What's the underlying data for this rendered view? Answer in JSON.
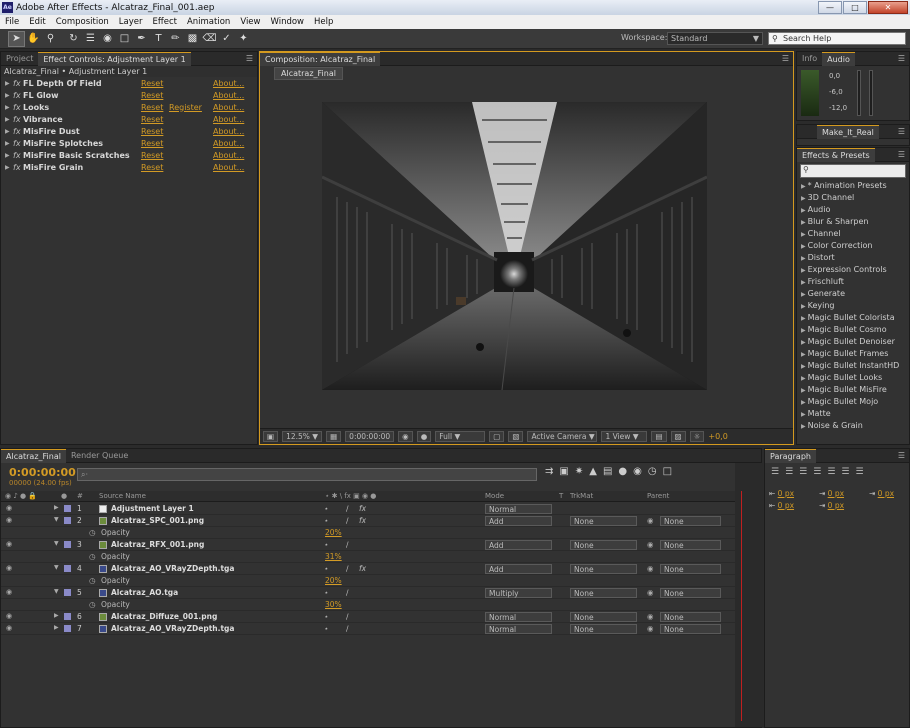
{
  "window": {
    "title": "Adobe After Effects - Alcatraz_Final_001.aep",
    "logo": "Ae"
  },
  "menu": [
    "File",
    "Edit",
    "Composition",
    "Layer",
    "Effect",
    "Animation",
    "View",
    "Window",
    "Help"
  ],
  "toolbar": {
    "workspace_label": "Workspace:",
    "workspace_value": "Standard",
    "search_placeholder": "Search Help"
  },
  "project_panel": {
    "tab_project": "Project",
    "tab_effect_controls": "Effect Controls: Adjustment Layer 1",
    "subtitle": "Alcatraz_Final • Adjustment Layer 1"
  },
  "effects": [
    {
      "name": "FL Depth Of Field",
      "reset": "Reset",
      "register": "",
      "about": "About..."
    },
    {
      "name": "FL Glow",
      "reset": "Reset",
      "register": "",
      "about": "About..."
    },
    {
      "name": "Looks",
      "reset": "Reset",
      "register": "Register",
      "about": "About..."
    },
    {
      "name": "Vibrance",
      "reset": "Reset",
      "register": "",
      "about": "About..."
    },
    {
      "name": "MisFire Dust",
      "reset": "Reset",
      "register": "",
      "about": "About..."
    },
    {
      "name": "MisFire Splotches",
      "reset": "Reset",
      "register": "",
      "about": "About..."
    },
    {
      "name": "MisFire Basic Scratches",
      "reset": "Reset",
      "register": "",
      "about": "About..."
    },
    {
      "name": "MisFire Grain",
      "reset": "Reset",
      "register": "",
      "about": "About..."
    }
  ],
  "composition": {
    "tab": "Composition: Alcatraz_Final",
    "sub_tab": "Alcatraz_Final",
    "zoom": "12.5%",
    "timecode": "0:00:00:00",
    "resolution": "Full",
    "camera": "Active Camera",
    "view": "1 View",
    "exposure": "+0,0"
  },
  "info_panel": {
    "tab_info": "Info",
    "tab_audio": "Audio",
    "levels": [
      "0,0",
      "-6,0",
      "-12,0"
    ]
  },
  "make_it_real": {
    "tab": "Make_It_Real"
  },
  "effects_presets": {
    "tab": "Effects & Presets",
    "items": [
      "* Animation Presets",
      "3D Channel",
      "Audio",
      "Blur & Sharpen",
      "Channel",
      "Color Correction",
      "Distort",
      "Expression Controls",
      "Frischluft",
      "Generate",
      "Keying",
      "Magic Bullet Colorista",
      "Magic Bullet Cosmo",
      "Magic Bullet Denoiser",
      "Magic Bullet Frames",
      "Magic Bullet InstantHD",
      "Magic Bullet Looks",
      "Magic Bullet MisFire",
      "Magic Bullet Mojo",
      "Matte",
      "Noise & Grain"
    ]
  },
  "timeline": {
    "tab_comp": "Alcatraz_Final",
    "tab_render": "Render Queue",
    "timecode": "0:00:00:00",
    "fps": "00000 (24.00 fps)",
    "search_placeholder": "⌕·",
    "headers": {
      "num": "#",
      "source": "Source Name",
      "mode": "Mode",
      "t": "T",
      "trkmat": "TrkMat",
      "parent": "Parent"
    },
    "rows": [
      {
        "type": "layer",
        "num": "1",
        "name": "Adjustment Layer 1",
        "icon": "solid",
        "mode": "",
        "trk": "",
        "parent": ""
      },
      {
        "type": "layer",
        "num": "2",
        "name": "Alcatraz_SPC_001.png",
        "icon": "png",
        "mode": "Add",
        "trk": "None",
        "parent": "None"
      },
      {
        "type": "prop",
        "name": "Opacity",
        "value": "20%"
      },
      {
        "type": "layer",
        "num": "3",
        "name": "Alcatraz_RFX_001.png",
        "icon": "png",
        "mode": "Add",
        "trk": "None",
        "parent": "None"
      },
      {
        "type": "prop",
        "name": "Opacity",
        "value": "31%"
      },
      {
        "type": "layer",
        "num": "4",
        "name": "Alcatraz_AO_VRayZDepth.tga",
        "icon": "tga",
        "mode": "Add",
        "trk": "None",
        "parent": "None"
      },
      {
        "type": "prop",
        "name": "Opacity",
        "value": "20%"
      },
      {
        "type": "layer",
        "num": "5",
        "name": "Alcatraz_AO.tga",
        "icon": "tga",
        "mode": "Multiply",
        "trk": "None",
        "parent": "None"
      },
      {
        "type": "prop",
        "name": "Opacity",
        "value": "30%"
      },
      {
        "type": "layer",
        "num": "6",
        "name": "Alcatraz_Diffuze_001.png",
        "icon": "png",
        "mode": "Normal",
        "trk": "None",
        "parent": "None"
      },
      {
        "type": "layer",
        "num": "7",
        "name": "Alcatraz_AO_VRayZDepth.tga",
        "icon": "tga",
        "mode": "Normal",
        "trk": "None",
        "parent": "None"
      }
    ],
    "first_mode": "Normal"
  },
  "paragraph": {
    "tab": "Paragraph",
    "fields": [
      "0 px",
      "0 px",
      "0 px",
      "0 px",
      "0 px"
    ]
  }
}
